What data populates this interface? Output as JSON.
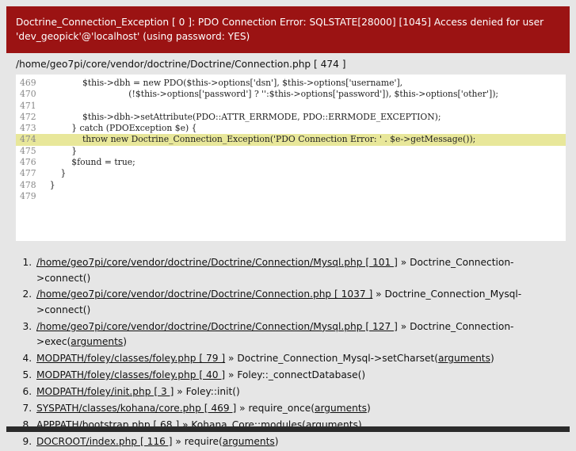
{
  "error": {
    "message": "Doctrine_Connection_Exception [ 0 ]: PDO Connection Error: SQLSTATE[28000] [1045] Access denied for user 'dev_geopick'@'localhost' (using password: YES)"
  },
  "source": {
    "file": "/home/geo7pi/core/vendor/doctrine/Doctrine/Connection.php [ 474 ]",
    "lines": [
      {
        "num": "469",
        "code": "                $this->dbh = new PDO($this->options['dsn'], $this->options['username'],",
        "highlight": false
      },
      {
        "num": "470",
        "code": "                                 (!$this->options['password'] ? '':$this->options['password']), $this->options['other']);",
        "highlight": false
      },
      {
        "num": "471",
        "code": "",
        "highlight": false
      },
      {
        "num": "472",
        "code": "                $this->dbh->setAttribute(PDO::ATTR_ERRMODE, PDO::ERRMODE_EXCEPTION);",
        "highlight": false
      },
      {
        "num": "473",
        "code": "            } catch (PDOException $e) {",
        "highlight": false
      },
      {
        "num": "474",
        "code": "                throw new Doctrine_Connection_Exception('PDO Connection Error: ' . $e->getMessage());",
        "highlight": true
      },
      {
        "num": "475",
        "code": "            }",
        "highlight": false
      },
      {
        "num": "476",
        "code": "            $found = true;",
        "highlight": false
      },
      {
        "num": "477",
        "code": "        }",
        "highlight": false
      },
      {
        "num": "478",
        "code": "    }",
        "highlight": false
      },
      {
        "num": "479",
        "code": "",
        "highlight": false
      }
    ]
  },
  "trace": [
    {
      "file": "/home/geo7pi/core/vendor/doctrine/Doctrine/Connection/Mysql.php [ 101 ]",
      "call": " » Doctrine_Connection->connect()",
      "args": ""
    },
    {
      "file": "/home/geo7pi/core/vendor/doctrine/Doctrine/Connection.php [ 1037 ]",
      "call": " » Doctrine_Connection_Mysql->connect()",
      "args": ""
    },
    {
      "file": "/home/geo7pi/core/vendor/doctrine/Doctrine/Connection/Mysql.php [ 127 ]",
      "call": " » Doctrine_Connection->exec(",
      "args": "arguments"
    },
    {
      "file": "MODPATH/foley/classes/foley.php [ 79 ]",
      "call": " » Doctrine_Connection_Mysql->setCharset(",
      "args": "arguments"
    },
    {
      "file": "MODPATH/foley/classes/foley.php [ 40 ]",
      "call": " » Foley::_connectDatabase()",
      "args": ""
    },
    {
      "file": "MODPATH/foley/init.php [ 3 ]",
      "call": " » Foley::init()",
      "args": ""
    },
    {
      "file": "SYSPATH/classes/kohana/core.php [ 469 ]",
      "call": " » require_once(",
      "args": "arguments"
    },
    {
      "file": "APPPATH/bootstrap.php [ 68 ]",
      "call": " » Kohana_Core::modules(",
      "args": "arguments"
    },
    {
      "file": "DOCROOT/index.php [ 116 ]",
      "call": " » require(",
      "args": "arguments"
    }
  ],
  "colors": {
    "header_bg": "#9b1313",
    "highlight_bg": "#e8e79a",
    "page_bg": "#e6e6e6"
  }
}
